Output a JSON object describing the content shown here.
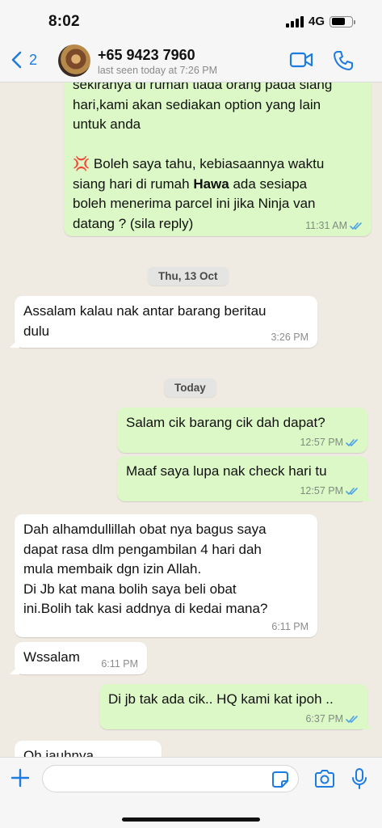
{
  "status_bar": {
    "time": "8:02",
    "network": "4G"
  },
  "header": {
    "back_count": "2",
    "contact_name": "+65 9423 7960",
    "last_seen": "last seen today at 7:26 PM"
  },
  "messages": {
    "m1": {
      "top_cut_text": "sekiranya di rumah tiada orang pada siang",
      "lines_a": [
        "hari,kami akan sediakan option yang lain",
        "untuk anda"
      ],
      "emoji": "💢",
      "line_b1": " Boleh saya tahu, kebiasaannya waktu",
      "line_b2": "siang hari di rumah ",
      "line_b2_bold": "Hawa",
      "line_b2_rest": " ada sesiapa",
      "line_b3": "boleh menerima parcel ini jika Ninja van",
      "line_b4": "datang ? (sila reply)",
      "time": "11:31 AM"
    },
    "date1": "Thu, 13 Oct",
    "m2": {
      "line1": "Assalam kalau nak antar barang beritau",
      "line2": "dulu",
      "time": "3:26 PM"
    },
    "date2": "Today",
    "m3": {
      "text": "Salam cik barang cik dah dapat?",
      "time": "12:57 PM"
    },
    "m4": {
      "text": "Maaf saya lupa nak check hari tu",
      "time": "12:57 PM"
    },
    "m5": {
      "line1": "Dah alhamdullillah obat nya bagus saya",
      "line2": "dapat rasa dlm pengambilan 4 hari dah",
      "line3": "mula membaik dgn izin Allah.",
      "line4": "Di Jb kat mana bolih saya beli obat",
      "line5": "ini.Bolih tak kasi addnya di kedai mana?",
      "time": "6:11 PM"
    },
    "m6": {
      "text": "Wssalam",
      "time": "6:11 PM"
    },
    "m7": {
      "text": "Di jb tak ada cik.. HQ kami kat ipoh ..",
      "time": "6:37 PM"
    },
    "m8": {
      "text": "Oh jauhnya"
    }
  },
  "colors": {
    "accent": "#1e7be0",
    "outgoing_bubble": "#dcf8c6",
    "incoming_bubble": "#ffffff",
    "chat_background": "#efeae2",
    "read_ticks": "#4fa3e6"
  },
  "icons": {
    "back": "chevron-left-icon",
    "video": "video-camera-icon",
    "call": "phone-icon",
    "attach": "plus-icon",
    "sticker": "sticker-icon",
    "camera": "camera-icon",
    "mic": "microphone-icon",
    "read": "double-check-icon"
  }
}
